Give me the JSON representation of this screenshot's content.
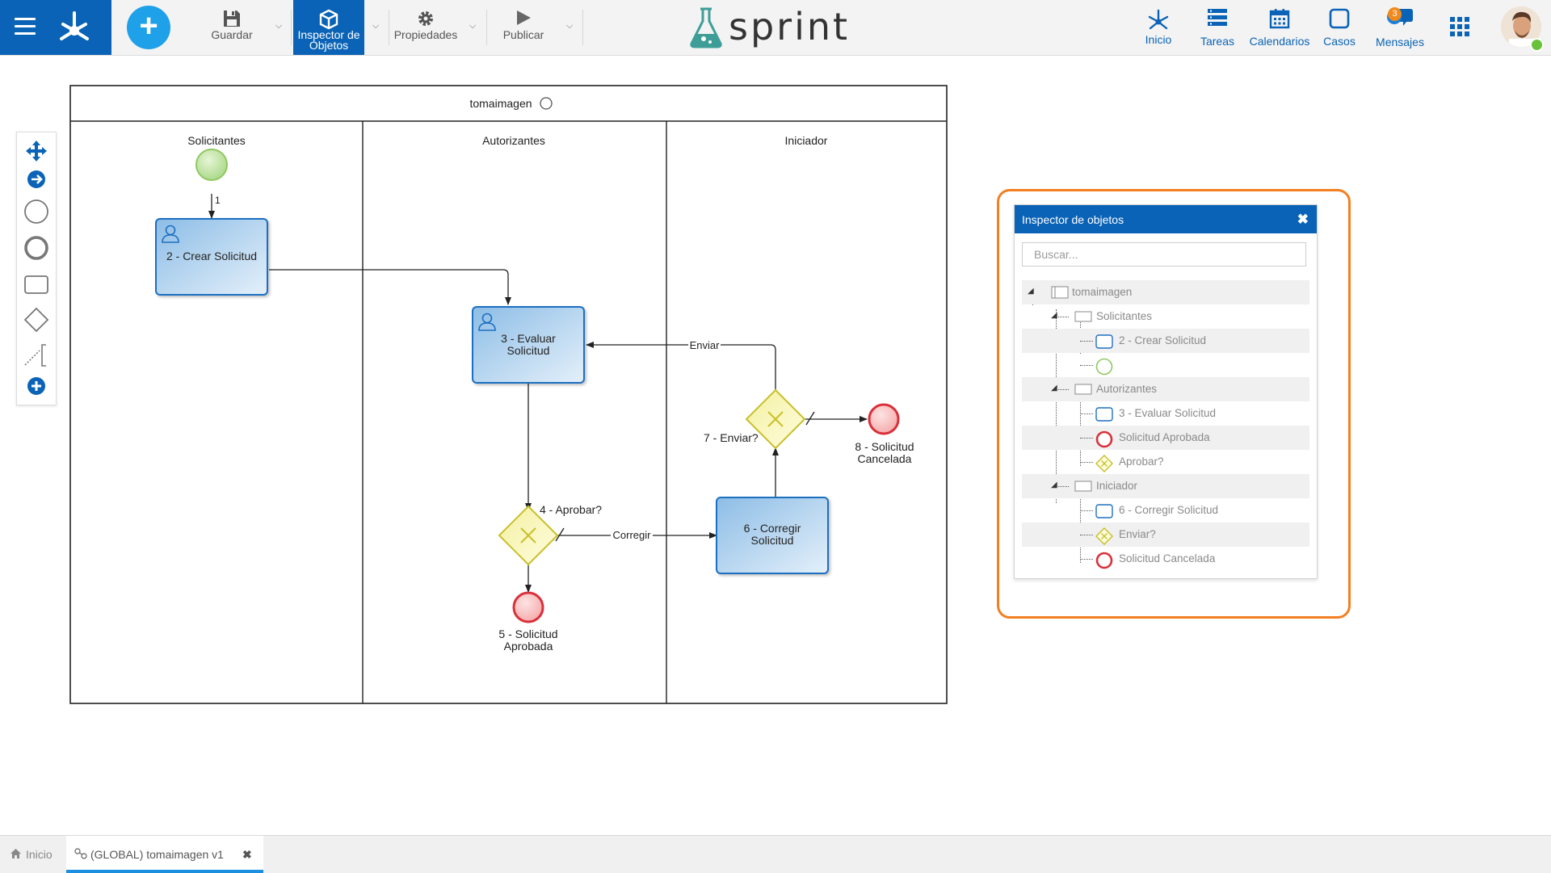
{
  "toolbar": {
    "save_label": "Guardar",
    "inspector_label_line1": "Inspector de",
    "inspector_label_line2": "Objetos",
    "properties_label": "Propiedades",
    "publish_label": "Publicar",
    "brand_name": "sprint"
  },
  "nav": {
    "items": [
      {
        "label": "Inicio",
        "icon": "home-network-icon"
      },
      {
        "label": "Tareas",
        "icon": "tasks-icon"
      },
      {
        "label": "Calendarios",
        "icon": "calendar-icon"
      },
      {
        "label": "Casos",
        "icon": "cases-icon"
      },
      {
        "label": "Mensajes",
        "icon": "chat-icon"
      }
    ],
    "messages_badge": "3"
  },
  "diagram": {
    "pool_name": "tomaimagen",
    "lanes": [
      "Solicitantes",
      "Autorizantes",
      "Iniciador"
    ],
    "tasks": {
      "crear_l1": "2 - Crear Solicitud",
      "evaluar_l1": "3 - Evaluar",
      "evaluar_l2": "Solicitud",
      "corregir_l1": "6 - Corregir",
      "corregir_l2": "Solicitud"
    },
    "gateways": {
      "aprobar": "4 - Aprobar?",
      "enviar": "7 - Enviar?"
    },
    "end_events": {
      "aprobada_l1": "5 - Solicitud",
      "aprobada_l2": "Aprobada",
      "cancelada_l1": "8 - Solicitud",
      "cancelada_l2": "Cancelada"
    },
    "flows": {
      "seq1": "1",
      "enviar": "Enviar",
      "corregir": "Corregir"
    }
  },
  "inspector": {
    "title": "Inspector de objetos",
    "search_placeholder": "Buscar...",
    "tree": [
      {
        "label": "tomaimagen",
        "type": "pool",
        "level": 0
      },
      {
        "label": "Solicitantes",
        "type": "lane",
        "level": 1
      },
      {
        "label": "2 - Crear Solicitud",
        "type": "task",
        "level": 2
      },
      {
        "label": "",
        "type": "start",
        "level": 2
      },
      {
        "label": "Autorizantes",
        "type": "lane",
        "level": 1
      },
      {
        "label": "3 - Evaluar Solicitud",
        "type": "task",
        "level": 2
      },
      {
        "label": "Solicitud Aprobada",
        "type": "end",
        "level": 2
      },
      {
        "label": "Aprobar?",
        "type": "gateway",
        "level": 2
      },
      {
        "label": "Iniciador",
        "type": "lane",
        "level": 1
      },
      {
        "label": "6 - Corregir Solicitud",
        "type": "task",
        "level": 2
      },
      {
        "label": "Enviar?",
        "type": "gateway",
        "level": 2
      },
      {
        "label": "Solicitud Cancelada",
        "type": "end",
        "level": 2
      }
    ]
  },
  "bottom_tabs": [
    {
      "label": "Inicio",
      "icon": "home-icon"
    },
    {
      "label": "(GLOBAL) tomaimagen v1",
      "icon": "process-icon",
      "close": "✖"
    }
  ],
  "colors": {
    "primary": "#0a63b6",
    "add_button": "#1ea1e8",
    "highlight": "#f47f21",
    "start_event": "#8fc862",
    "end_event": "#d9303a",
    "gateway": "#e6e04a"
  }
}
